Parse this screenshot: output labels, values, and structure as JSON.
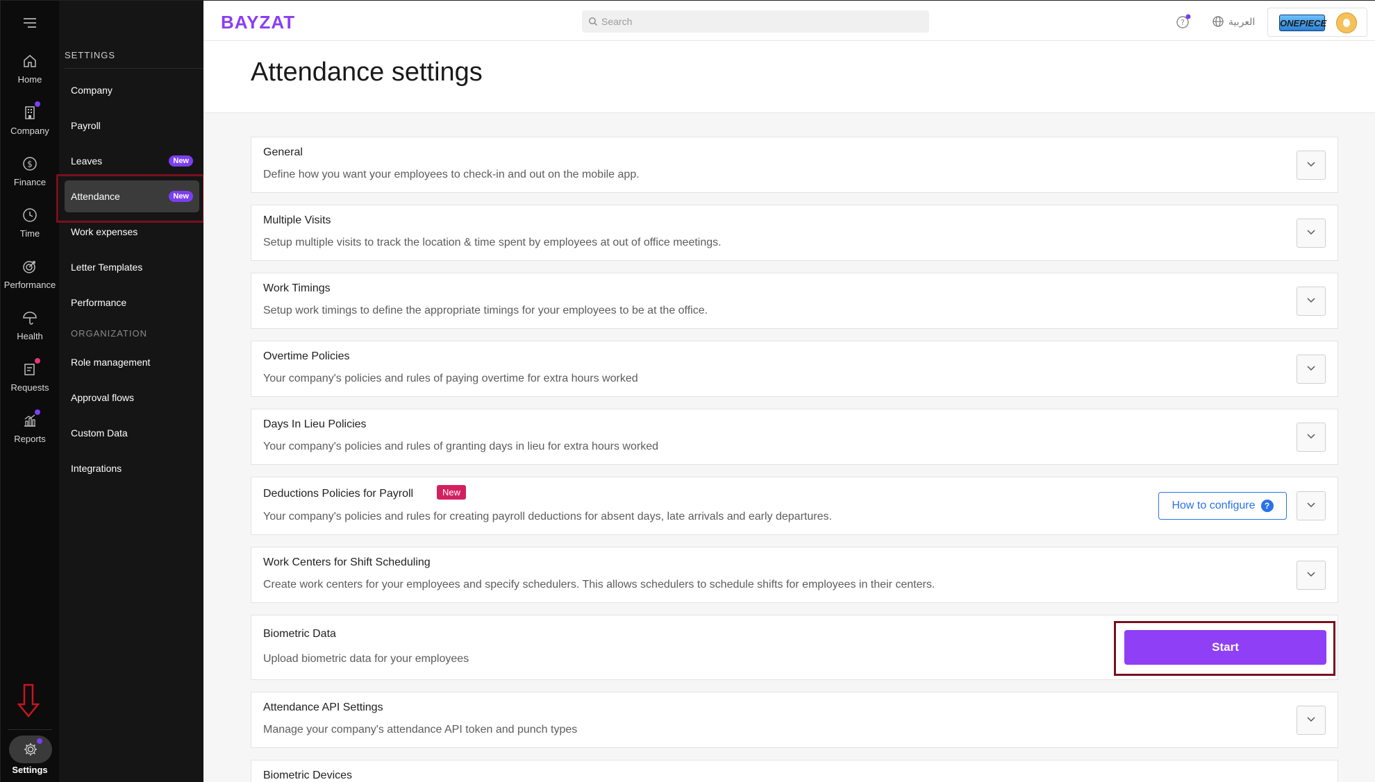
{
  "rail": {
    "items": [
      {
        "label": "Home",
        "icon": "home-icon"
      },
      {
        "label": "Company",
        "icon": "building-icon",
        "dot": "#7b3ff2"
      },
      {
        "label": "Finance",
        "icon": "dollar-icon"
      },
      {
        "label": "Time",
        "icon": "clock-icon"
      },
      {
        "label": "Performance",
        "icon": "target-icon"
      },
      {
        "label": "Health",
        "icon": "umbrella-icon"
      },
      {
        "label": "Requests",
        "icon": "request-icon",
        "dot": "#e6347a"
      },
      {
        "label": "Reports",
        "icon": "chart-icon",
        "dot": "#7b3ff2"
      }
    ],
    "settings_label": "Settings"
  },
  "subnav": {
    "section_settings": "SETTINGS",
    "section_organization": "ORGANIZATION",
    "items": [
      {
        "label": "Company"
      },
      {
        "label": "Payroll"
      },
      {
        "label": "Leaves",
        "badge": "New"
      },
      {
        "label": "Attendance",
        "badge": "New"
      },
      {
        "label": "Work expenses"
      },
      {
        "label": "Letter Templates"
      },
      {
        "label": "Performance"
      },
      {
        "label": "Role management"
      },
      {
        "label": "Approval flows"
      },
      {
        "label": "Custom Data"
      },
      {
        "label": "Integrations"
      }
    ]
  },
  "topbar": {
    "logo": "BAYZAT",
    "search_placeholder": "Search",
    "language": "العربية",
    "company_logo_text": "ONEPIECE"
  },
  "page": {
    "title": "Attendance settings"
  },
  "cards": [
    {
      "title": "General",
      "desc": "Define how you want your employees to check-in and out on the mobile app."
    },
    {
      "title": "Multiple Visits",
      "desc": "Setup multiple visits to track the location & time spent by employees at out of office meetings."
    },
    {
      "title": "Work Timings",
      "desc": "Setup work timings to define the appropriate timings for your employees to be at the office."
    },
    {
      "title": "Overtime Policies",
      "desc": "Your company's policies and rules of paying overtime for extra hours worked"
    },
    {
      "title": "Days In Lieu Policies",
      "desc": "Your company's policies and rules of granting days in lieu for extra hours worked"
    },
    {
      "title": "Deductions Policies for Payroll",
      "tag": "New",
      "desc": "Your company's policies and rules for creating payroll deductions for absent days, late arrivals and early departures.",
      "button": "How to configure"
    },
    {
      "title": "Work Centers for Shift Scheduling",
      "desc": "Create work centers for your employees and specify schedulers. This allows schedulers to schedule shifts for employees in their centers."
    },
    {
      "title": "Biometric Data",
      "desc": "Upload biometric data for your employees",
      "button": "Start"
    },
    {
      "title": "Attendance API Settings",
      "desc": "Manage your company's attendance API token and punch types"
    },
    {
      "title": "Biometric Devices"
    }
  ],
  "colors": {
    "brand": "#8b3df5",
    "highlight": "#7a0f1e",
    "new_badge": "#7b3ff2",
    "new_tag": "#d3215f",
    "link": "#2a72e8"
  }
}
